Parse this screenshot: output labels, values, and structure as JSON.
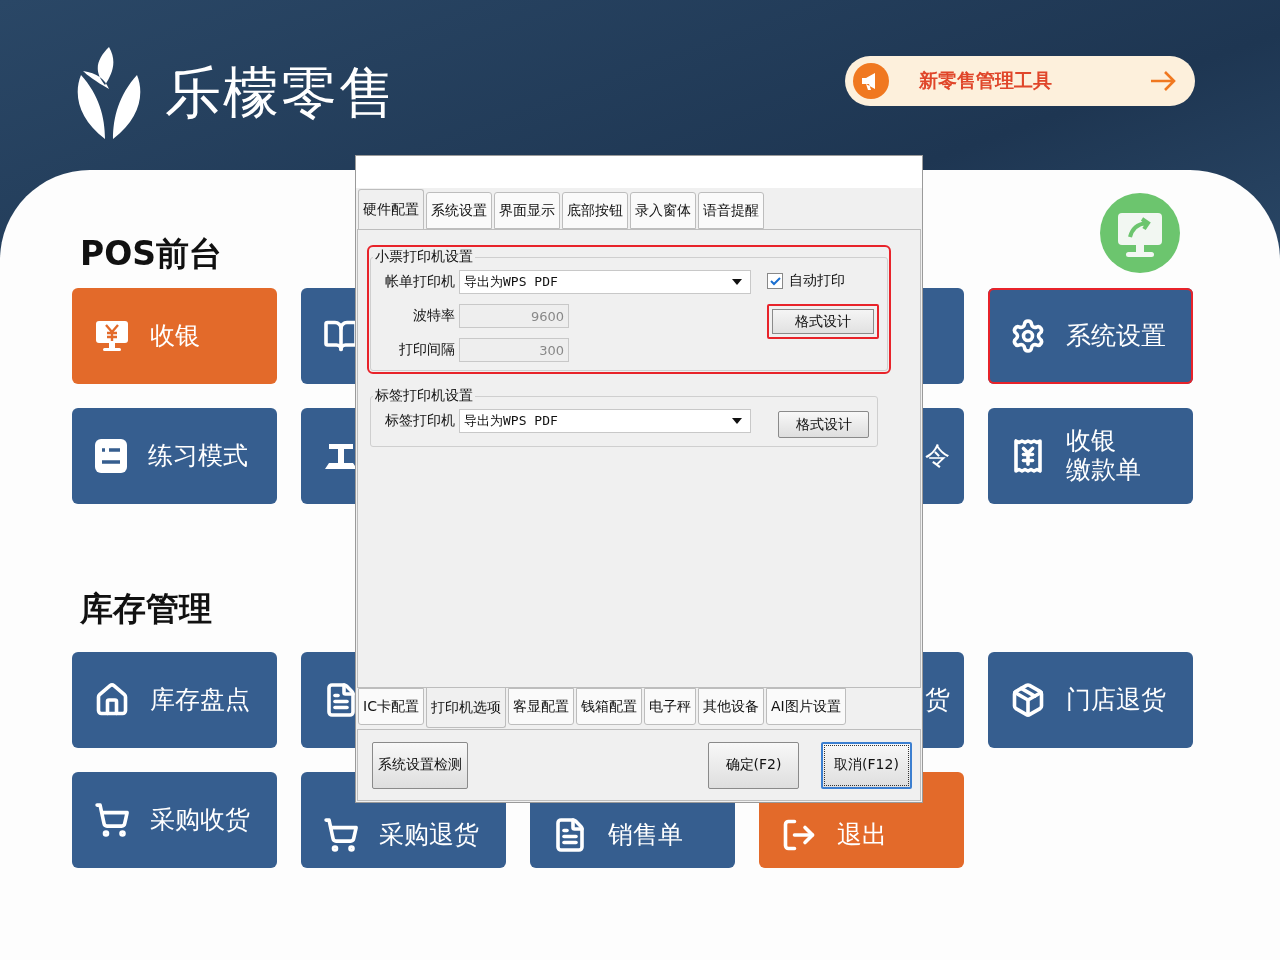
{
  "header": {
    "brand": "乐檬零售",
    "promo_button": "新零售管理工具"
  },
  "sections": [
    {
      "title": "POS前台",
      "tiles": [
        {
          "kind": "tile",
          "label": "收银",
          "color": "#e36a2a",
          "highlighted": false
        },
        {
          "kind": "tile",
          "color": "#365e8f",
          "highlighted": false
        },
        {
          "kind": "covered"
        },
        {
          "kind": "tile",
          "color": "#365e8f",
          "highlighted": false
        },
        {
          "kind": "tile",
          "label": "系统设置",
          "color": "#365e8f",
          "highlighted": true
        },
        {
          "kind": "tile",
          "label": "练习模式",
          "color": "#365e8f",
          "highlighted": false
        },
        {
          "kind": "tile",
          "color": "#365e8f",
          "highlighted": false
        },
        {
          "kind": "covered"
        },
        {
          "kind": "edge",
          "label": "令",
          "color": "#365e8f",
          "highlighted": false
        },
        {
          "kind": "tile",
          "lines": [
            "收银",
            "缴款单"
          ],
          "color": "#365e8f",
          "highlighted": false
        }
      ]
    },
    {
      "title": "库存管理",
      "tiles": [
        {
          "kind": "tile",
          "label": "库存盘点",
          "color": "#365e8f",
          "highlighted": false
        },
        {
          "kind": "tile",
          "color": "#365e8f",
          "highlighted": false
        },
        {
          "kind": "covered"
        },
        {
          "kind": "edge",
          "label": "货",
          "color": "#365e8f",
          "highlighted": false
        },
        {
          "kind": "tile",
          "label": "门店退货",
          "color": "#365e8f",
          "highlighted": false
        },
        {
          "kind": "tile",
          "label": "采购收货",
          "color": "#365e8f",
          "highlighted": false
        },
        {
          "kind": "low",
          "label": "采购退货",
          "color": "#365e8f",
          "highlighted": false
        },
        {
          "kind": "low",
          "label": "销售单",
          "color": "#365e8f",
          "highlighted": false
        },
        {
          "kind": "low",
          "label": "退出",
          "color": "#e36a2a",
          "highlighted": false
        }
      ]
    }
  ],
  "dialog": {
    "top_tabs": [
      {
        "label": "硬件配置",
        "selected": true
      },
      {
        "label": "系统设置",
        "selected": false
      },
      {
        "label": "界面显示",
        "selected": false
      },
      {
        "label": "底部按钮",
        "selected": false
      },
      {
        "label": "录入窗体",
        "selected": false
      },
      {
        "label": "语音提醒",
        "selected": false
      }
    ],
    "groups": [
      {
        "title": "小票打印机设置",
        "highlighted": true,
        "printer_label": "帐单打印机",
        "printer_value": "导出为WPS PDF",
        "auto_print": {
          "label": "自动打印",
          "checked": true
        },
        "fields": [
          {
            "label": "波特率",
            "value": "9600",
            "disabled": true
          },
          {
            "label": "打印间隔",
            "value": "300",
            "disabled": true
          }
        ],
        "format_button": {
          "label": "格式设计",
          "highlighted": true
        }
      },
      {
        "title": "标签打印机设置",
        "highlighted": false,
        "printer_label": "标签打印机",
        "printer_value": "导出为WPS PDF",
        "format_button": {
          "label": "格式设计",
          "highlighted": false
        }
      }
    ],
    "bottom_tabs": [
      {
        "label": "IC卡配置",
        "selected": false
      },
      {
        "label": "打印机选项",
        "selected": true
      },
      {
        "label": "客显配置",
        "selected": false
      },
      {
        "label": "钱箱配置",
        "selected": false
      },
      {
        "label": "电子秤",
        "selected": false
      },
      {
        "label": "其他设备",
        "selected": false
      },
      {
        "label": "AI图片设置",
        "selected": false
      }
    ],
    "buttons": [
      {
        "label": "系统设置检测",
        "focused": false
      },
      {
        "label": "确定(F2)",
        "focused": false
      },
      {
        "label": "取消(F12)",
        "focused": true
      }
    ]
  }
}
